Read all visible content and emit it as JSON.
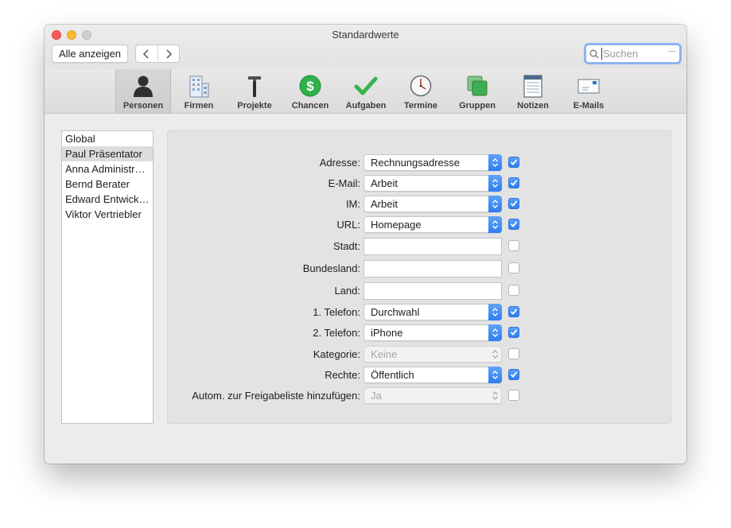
{
  "window": {
    "title": "Standardwerte"
  },
  "nav": {
    "show_all": "Alle anzeigen"
  },
  "search": {
    "placeholder": "Suchen"
  },
  "toolbar": {
    "items": [
      {
        "label": "Personen",
        "icon": "person-icon",
        "selected": true
      },
      {
        "label": "Firmen",
        "icon": "building-icon"
      },
      {
        "label": "Projekte",
        "icon": "hammer-icon"
      },
      {
        "label": "Chancen",
        "icon": "dollar-coin-icon"
      },
      {
        "label": "Aufgaben",
        "icon": "checkmark-icon"
      },
      {
        "label": "Termine",
        "icon": "clock-icon"
      },
      {
        "label": "Gruppen",
        "icon": "groups-icon"
      },
      {
        "label": "Notizen",
        "icon": "notes-icon"
      },
      {
        "label": "E-Mails",
        "icon": "envelope-icon"
      }
    ]
  },
  "users": {
    "items": [
      "Global",
      "Paul Präsentator",
      "Anna Administr…",
      "Bernd Berater",
      "Edward Entwick…",
      "Viktor Vertriebler"
    ],
    "selected": "Paul Präsentator"
  },
  "form": {
    "rows": [
      {
        "label": "Adresse:",
        "type": "popup",
        "value": "Rechnungsadresse",
        "checked": true
      },
      {
        "label": "E-Mail:",
        "type": "popup",
        "value": "Arbeit",
        "checked": true
      },
      {
        "label": "IM:",
        "type": "popup",
        "value": "Arbeit",
        "checked": true
      },
      {
        "label": "URL:",
        "type": "popup",
        "value": "Homepage",
        "checked": true
      },
      {
        "label": "Stadt:",
        "type": "text",
        "value": "",
        "checked": false
      },
      {
        "label": "Bundesland:",
        "type": "text",
        "value": "",
        "checked": false
      },
      {
        "label": "Land:",
        "type": "text",
        "value": "",
        "checked": false
      },
      {
        "label": "1. Telefon:",
        "type": "popup",
        "value": "Durchwahl",
        "checked": true
      },
      {
        "label": "2. Telefon:",
        "type": "popup",
        "value": "iPhone",
        "checked": true
      },
      {
        "label": "Kategorie:",
        "type": "popup-disabled",
        "value": "Keine",
        "checked": false
      },
      {
        "label": "Rechte:",
        "type": "popup",
        "value": "Öffentlich",
        "checked": true
      },
      {
        "label": "Autom. zur Freigabeliste hinzufügen:",
        "type": "popup-disabled",
        "value": "Ja",
        "checked": false
      }
    ]
  },
  "colors": {
    "accent": "#2f7ef1",
    "window_bg": "#ececec",
    "panel_bg": "#e3e3e3"
  }
}
